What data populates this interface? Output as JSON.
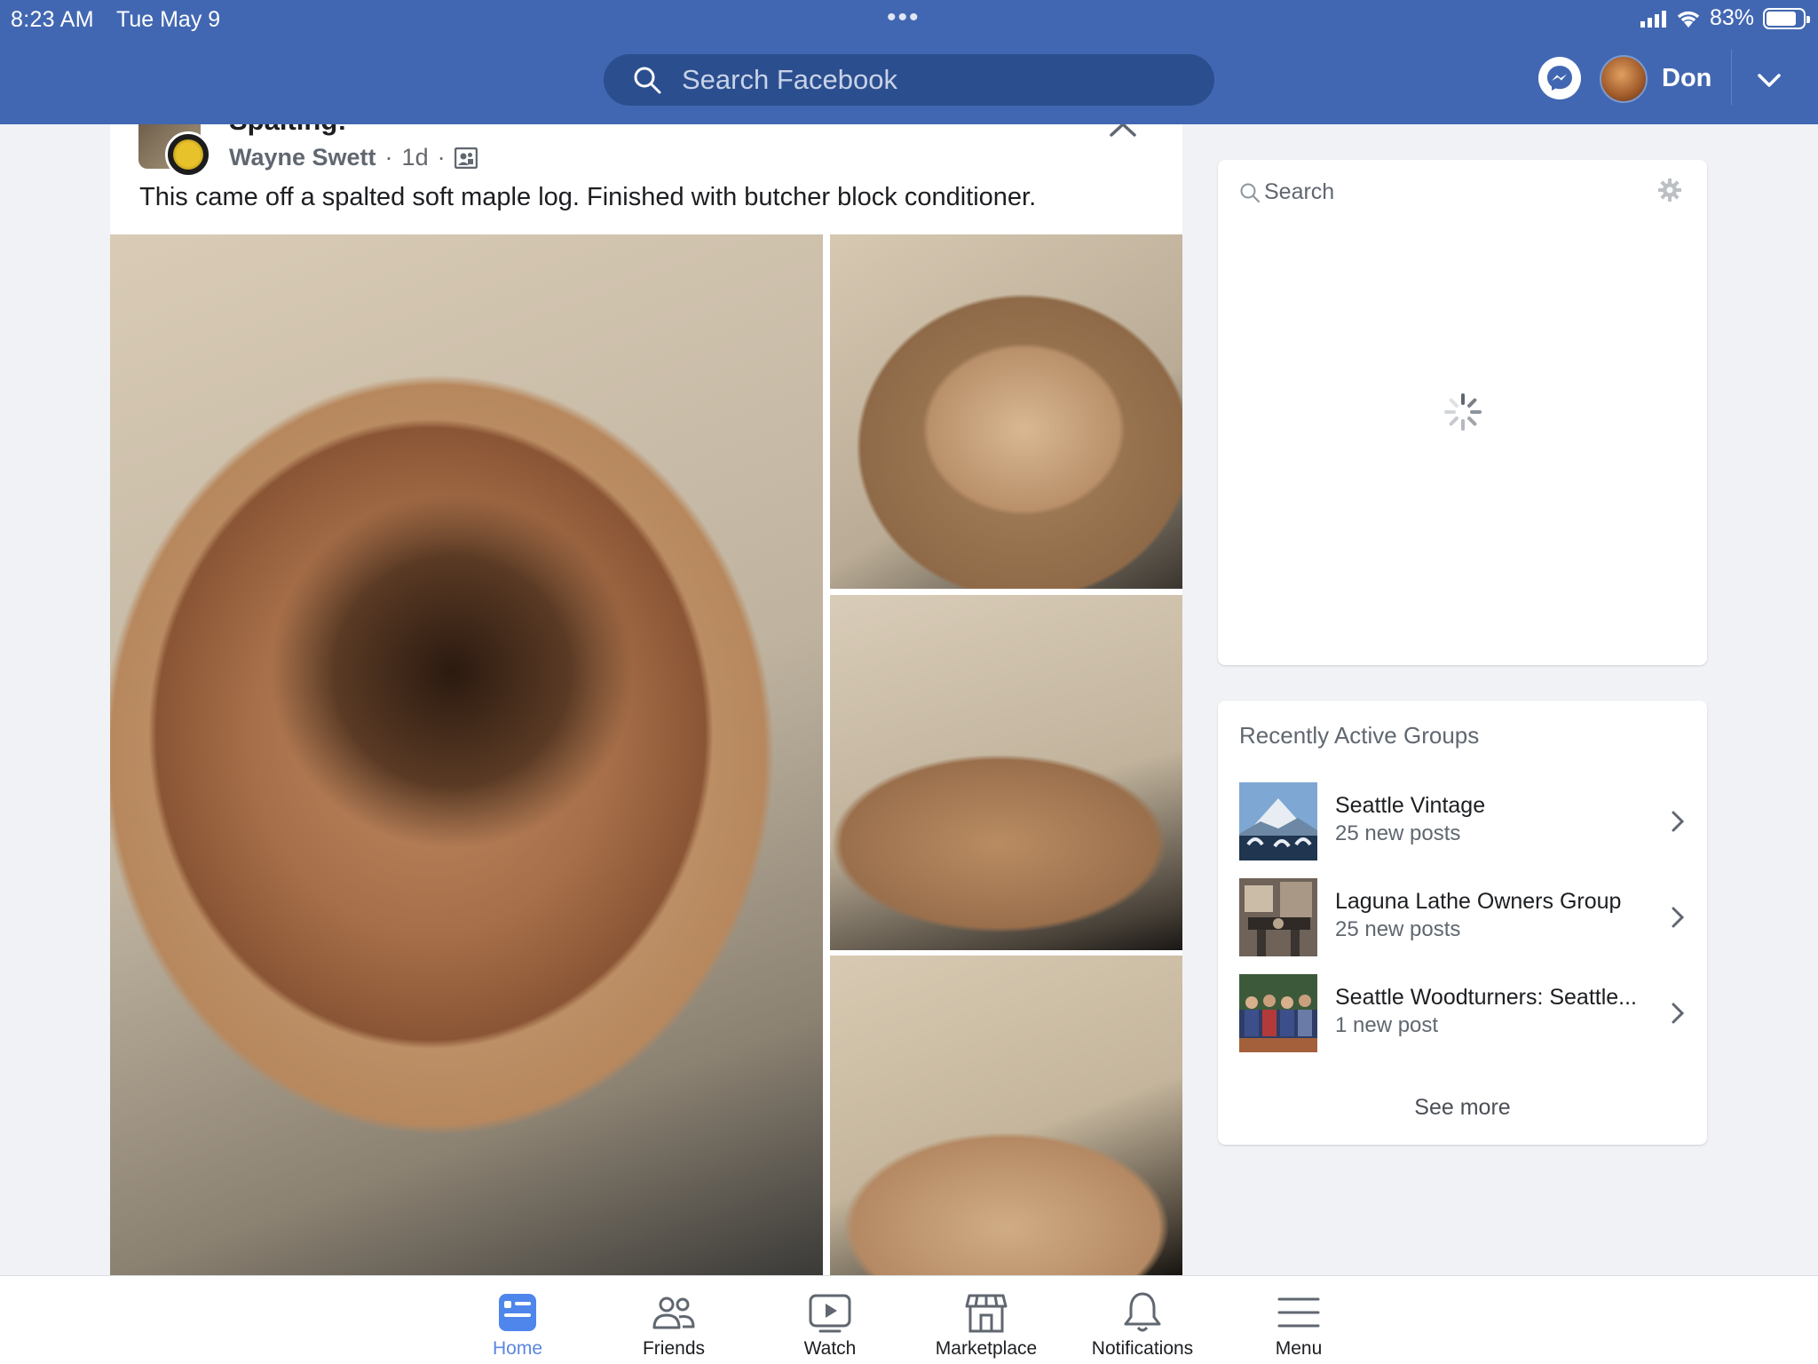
{
  "status_bar": {
    "time": "8:23 AM",
    "date": "Tue May 9",
    "dots": "•••",
    "battery": "83%",
    "battery_level": 0.83
  },
  "header": {
    "search_placeholder": "Search Facebook",
    "user_name": "Don",
    "brand_color": "#4267b2"
  },
  "post": {
    "title": "Spalting!",
    "author": "Wayne Swett",
    "time": "1d",
    "separator": "·",
    "text": "This came off a spalted soft maple log. Finished with butcher block conditioner.",
    "photos": [
      "bowl-interior",
      "bowl-top",
      "bowl-side",
      "bowl-side-2"
    ]
  },
  "sidebar": {
    "search_label": "Search",
    "groups_heading": "Recently Active Groups",
    "groups": [
      {
        "name": "Seattle Vintage",
        "sub": "25 new posts"
      },
      {
        "name": "Laguna Lathe Owners Group",
        "sub": "25 new posts"
      },
      {
        "name": "Seattle Woodturners: Seattle...",
        "sub": "1 new post"
      }
    ],
    "see_more": "See more"
  },
  "tabs": [
    {
      "label": "Home",
      "icon": "home-icon",
      "active": true
    },
    {
      "label": "Friends",
      "icon": "friends-icon"
    },
    {
      "label": "Watch",
      "icon": "watch-icon"
    },
    {
      "label": "Marketplace",
      "icon": "marketplace-icon"
    },
    {
      "label": "Notifications",
      "icon": "bell-icon"
    },
    {
      "label": "Menu",
      "icon": "menu-icon"
    }
  ]
}
